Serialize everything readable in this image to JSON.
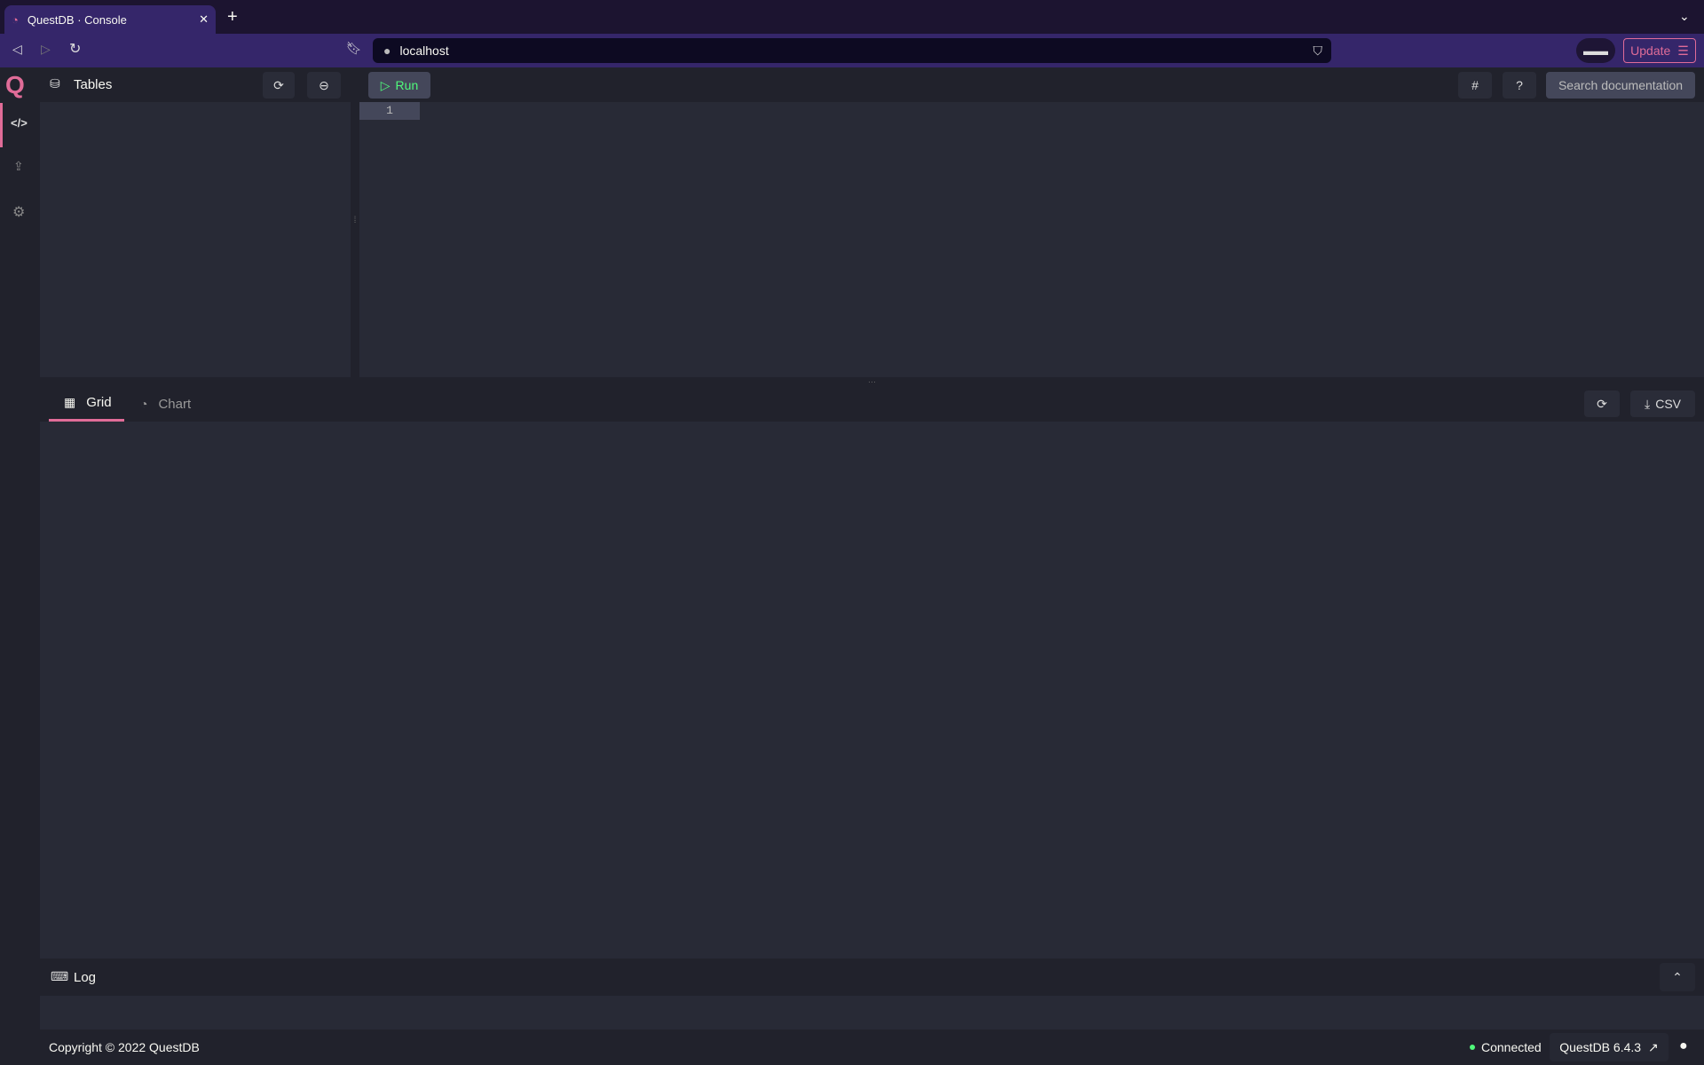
{
  "browser": {
    "tab_title": "QuestDB · Console",
    "url": "localhost",
    "update_label": "Update"
  },
  "header": {
    "tables_label": "Tables",
    "run_label": "Run",
    "search_placeholder": "Search documentation"
  },
  "editor": {
    "line_numbers": [
      "1"
    ]
  },
  "results": {
    "tabs": [
      {
        "label": "Grid",
        "active": true
      },
      {
        "label": "Chart",
        "active": false
      }
    ],
    "csv_label": "CSV"
  },
  "log": {
    "label": "Log"
  },
  "footer": {
    "copyright": "Copyright © 2022 QuestDB",
    "status": "Connected",
    "version": "QuestDB 6.4.3"
  },
  "colors": {
    "accent": "#e06c98",
    "run": "#50fa7b",
    "connected": "#50fa7b"
  }
}
